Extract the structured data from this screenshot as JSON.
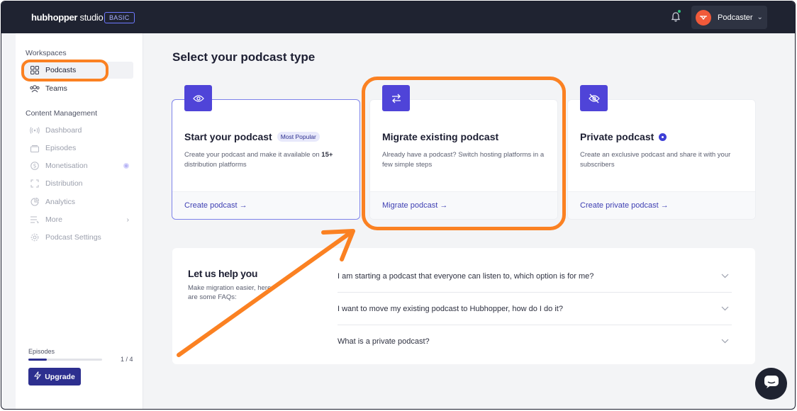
{
  "topbar": {
    "logo_bold": "hubhopper",
    "logo_light": " studio",
    "plan": "BASIC",
    "user_name": "Podcaster"
  },
  "sidebar": {
    "section_workspaces": "Workspaces",
    "workspaces": [
      {
        "label": "Podcasts",
        "icon": "grid-icon"
      },
      {
        "label": "Teams",
        "icon": "team-icon"
      }
    ],
    "section_content": "Content Management",
    "content_items": [
      {
        "label": "Dashboard",
        "icon": "broadcast-icon"
      },
      {
        "label": "Episodes",
        "icon": "episodes-icon"
      },
      {
        "label": "Monetisation",
        "icon": "dollar-icon"
      },
      {
        "label": "Distribution",
        "icon": "expand-icon"
      },
      {
        "label": "Analytics",
        "icon": "chart-icon"
      },
      {
        "label": "More",
        "icon": "list-icon"
      },
      {
        "label": "Podcast Settings",
        "icon": "gear-icon"
      }
    ],
    "episodes_label": "Episodes",
    "episodes_count": "1 / 4",
    "episodes_progress": 0.25,
    "upgrade_label": "Upgrade"
  },
  "main": {
    "title": "Select your podcast type",
    "cards": [
      {
        "title": "Start your podcast",
        "badge": "Most Popular",
        "desc_pre": "Create your podcast and make it available on ",
        "desc_bold": "15+",
        "desc_post": " distribution platforms",
        "link": "Create podcast →",
        "icon": "eye-icon"
      },
      {
        "title": "Migrate existing podcast",
        "desc": "Already have a podcast? Switch hosting platforms in a few simple steps",
        "link": "Migrate podcast →",
        "icon": "swap-arrows-icon"
      },
      {
        "title": "Private podcast",
        "desc": "Create an exclusive podcast and share it with your subscribers",
        "link": "Create private podcast →",
        "icon": "eye-off-icon"
      }
    ],
    "help": {
      "title": "Let us help you",
      "subtitle": "Make migration easier, here are some FAQs:",
      "faqs": [
        "I am starting a podcast that everyone can listen to, which option is for me?",
        "I want to move my existing podcast to Hubhopper, how do I do it?",
        "What is a private podcast?"
      ]
    }
  },
  "colors": {
    "accent": "#4f44d8",
    "highlight": "#fb8122",
    "topbar": "#1f2331"
  }
}
